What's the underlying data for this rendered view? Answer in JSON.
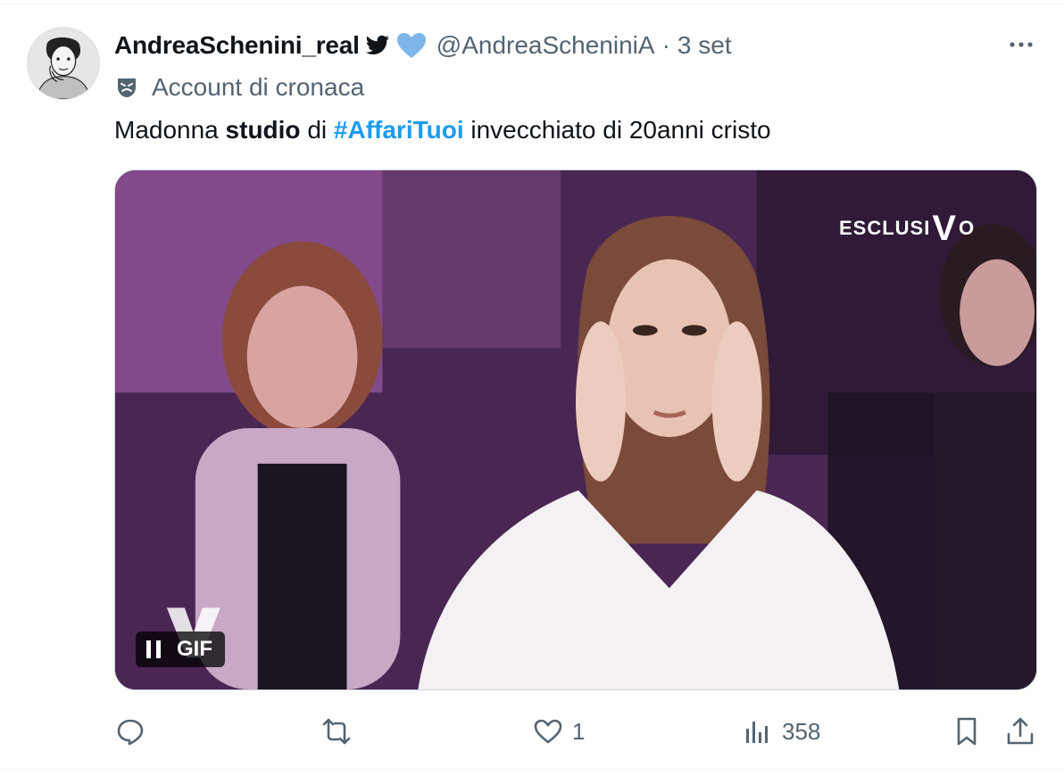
{
  "tweet": {
    "display_name": "AndreaSchenini_real",
    "handle": "@AndreaScheniniA",
    "separator": "·",
    "time": "3 set",
    "account_label": "Account di cronaca",
    "text_parts": {
      "p1": "Madonna ",
      "p2": "studio",
      "p3": " di ",
      "p4": "#AffariTuoi",
      "p5": " invecchiato di 20anni cristo"
    },
    "media": {
      "gif_label": "GIF",
      "watermark_left": "ESCLUSI",
      "watermark_v": "V",
      "watermark_right": "O"
    },
    "actions": {
      "reply_count": "",
      "retweet_count": "",
      "like_count": "1",
      "views_count": "358"
    }
  },
  "colors": {
    "text": "#0f1419",
    "secondary": "#536471",
    "accent": "#1d9bf0",
    "verified_heart": "#7fb6ea"
  },
  "icons": [
    "bird-icon",
    "heart-badge-icon",
    "more-icon",
    "mask-icon",
    "pause-icon",
    "reply-icon",
    "retweet-icon",
    "like-icon",
    "views-icon",
    "bookmark-icon",
    "share-icon"
  ]
}
